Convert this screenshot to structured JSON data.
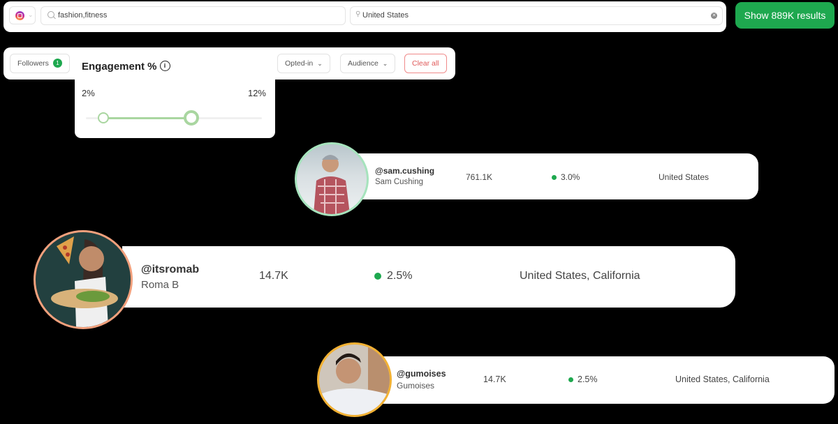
{
  "search": {
    "platform": "instagram",
    "platform_icon": "instagram-icon",
    "keywords_value": "fashion,fitness",
    "location_value": "United States",
    "show_results_label": "Show 889K results",
    "accent_color": "#1ea84f"
  },
  "filters": {
    "followers_label": "Followers",
    "followers_badge": "1",
    "opted_in_label": "Opted-in",
    "audience_label": "Audience",
    "clear_all_label": "Clear all"
  },
  "engagement": {
    "title": "Engagement %",
    "min_label": "2%",
    "max_label": "12%",
    "range_min": 2,
    "range_max": 12,
    "selected_low_fraction": 0.1,
    "selected_high_fraction": 0.6
  },
  "creators": [
    {
      "handle": "@sam.cushing",
      "name": "Sam Cushing",
      "followers": "761.1K",
      "engagement": "3.0%",
      "location": "United States",
      "ring_color": "#a6e3bd"
    },
    {
      "handle": "@itsromab",
      "name": "Roma B",
      "followers": "14.7K",
      "engagement": "2.5%",
      "location": "United States, California",
      "ring_color": "#f2a07c"
    },
    {
      "handle": "@gumoises",
      "name": "Gumoises",
      "followers": "14.7K",
      "engagement": "2.5%",
      "location": "United States, California",
      "ring_color": "#f2b133"
    }
  ]
}
